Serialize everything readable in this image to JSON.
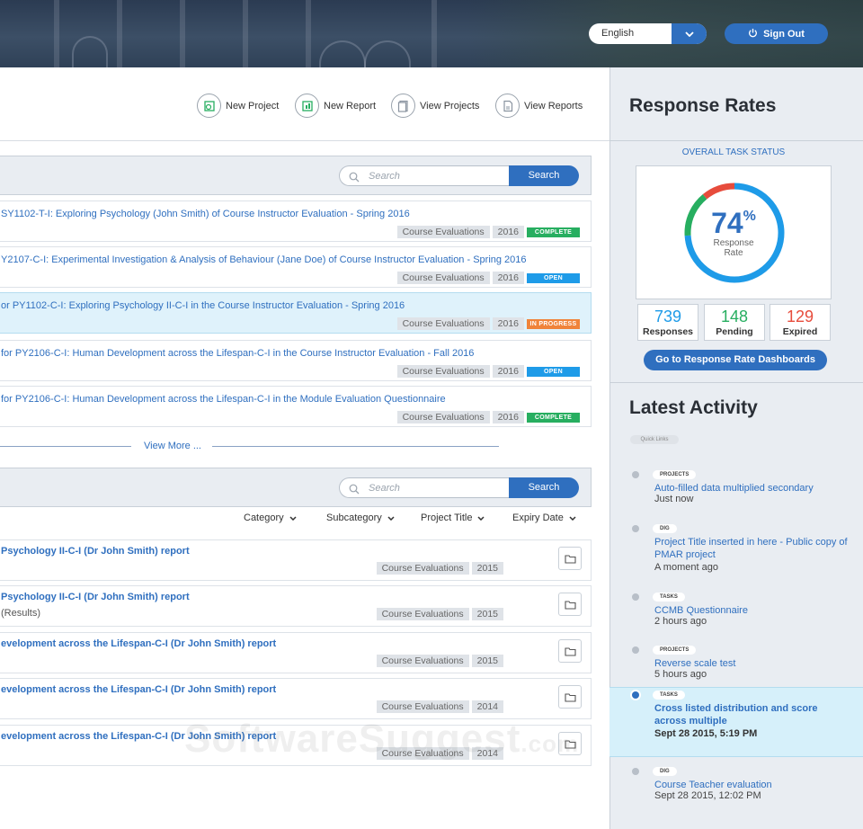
{
  "header": {
    "language": "English",
    "sign_out": "Sign Out"
  },
  "toolbar": {
    "new_project": "New Project",
    "new_report": "New Report",
    "view_projects": "View Projects",
    "view_reports": "View Reports"
  },
  "projects": {
    "search_placeholder": "Search",
    "search_button": "Search",
    "items": [
      {
        "title": "SY1102-T-I: Exploring Psychology (John Smith) of  Course Instructor Evaluation - Spring 2016",
        "category": "Course Evaluations",
        "year": "2016",
        "status": "COMPLETE",
        "status_color": "#27ae60"
      },
      {
        "title": "Y2107-C-I: Experimental Investigation & Analysis of Behaviour (Jane Doe) of Course Instructor Evaluation - Spring 2016",
        "category": "Course Evaluations",
        "year": "2016",
        "status": "OPEN",
        "status_color": "#1e9be8"
      },
      {
        "title": "or PY1102-C-I: Exploring Psychology II-C-I in the Course Instructor Evaluation - Spring 2016",
        "category": "Course Evaluations",
        "year": "2016",
        "status": "IN PROGRESS",
        "status_color": "#f0833a"
      },
      {
        "title": "for PY2106-C-I: Human Development across the Lifespan-C-I in the Course Instructor Evaluation - Fall 2016",
        "category": "Course Evaluations",
        "year": "2016",
        "status": "OPEN",
        "status_color": "#1e9be8"
      },
      {
        "title": "for PY2106-C-I: Human Development across the Lifespan-C-I in the Module Evaluation Questionnaire",
        "category": "Course Evaluations",
        "year": "2016",
        "status": "COMPLETE",
        "status_color": "#27ae60"
      }
    ],
    "view_more": "View More ..."
  },
  "reports": {
    "search_placeholder": "Search",
    "search_button": "Search",
    "sort": {
      "category": "Category",
      "subcategory": "Subcategory",
      "project_title": "Project Title",
      "expiry_date": "Expiry Date"
    },
    "items": [
      {
        "title": "Psychology II-C-I (Dr John Smith) report",
        "sub": "",
        "category": "Course Evaluations",
        "year": "2015"
      },
      {
        "title": "Psychology II-C-I (Dr John Smith) report",
        "sub": "(Results)",
        "category": "Course Evaluations",
        "year": "2015"
      },
      {
        "title": "evelopment across the Lifespan-C-I (Dr John Smith) report",
        "sub": "",
        "category": "Course Evaluations",
        "year": "2015"
      },
      {
        "title": "evelopment across the Lifespan-C-I (Dr John Smith) report",
        "sub": "",
        "category": "Course Evaluations",
        "year": "2014"
      },
      {
        "title": "evelopment across the Lifespan-C-I (Dr John Smith) report",
        "sub": "",
        "category": "Course Evaluations",
        "year": "2014"
      }
    ]
  },
  "watermark": {
    "main": "SoftwareSuggest",
    "suffix": ".com"
  },
  "response_rates": {
    "title": "Response Rates",
    "subtitle": "OVERALL TASK STATUS",
    "percent": "74",
    "percent_sign": "%",
    "percent_label_1": "Response",
    "percent_label_2": "Rate",
    "responses": {
      "value": "739",
      "label": "Responses",
      "color": "#1e9be8"
    },
    "pending": {
      "value": "148",
      "label": "Pending",
      "color": "#27ae60"
    },
    "expired": {
      "value": "129",
      "label": "Expired",
      "color": "#e74c3c"
    },
    "dashboard_button": "Go to Response Rate Dashboards",
    "donut": {
      "responses_fraction": 0.74,
      "pending_fraction": 0.15,
      "expired_fraction": 0.11
    }
  },
  "latest_activity": {
    "title": "Latest Activity",
    "quick_links": "Quick Links",
    "items": [
      {
        "tag": "PROJECTS",
        "text": "Auto-filled data multiplied secondary",
        "time": "Just now"
      },
      {
        "tag": "DIG",
        "text": "Project Title inserted in here - Public copy of PMAR project",
        "time": "A moment ago"
      },
      {
        "tag": "TASKS",
        "text": "CCMB Questionnaire",
        "time": "2 hours ago"
      },
      {
        "tag": "PROJECTS",
        "text": "Reverse scale test",
        "time": "5 hours ago"
      },
      {
        "tag": "TASKS",
        "text": "Cross listed distribution and score across multiple",
        "time": "Sept 28 2015, 5:19 PM"
      },
      {
        "tag": "DIG",
        "text": "Course Teacher evaluation",
        "time": "Sept 28 2015, 12:02 PM"
      }
    ]
  }
}
